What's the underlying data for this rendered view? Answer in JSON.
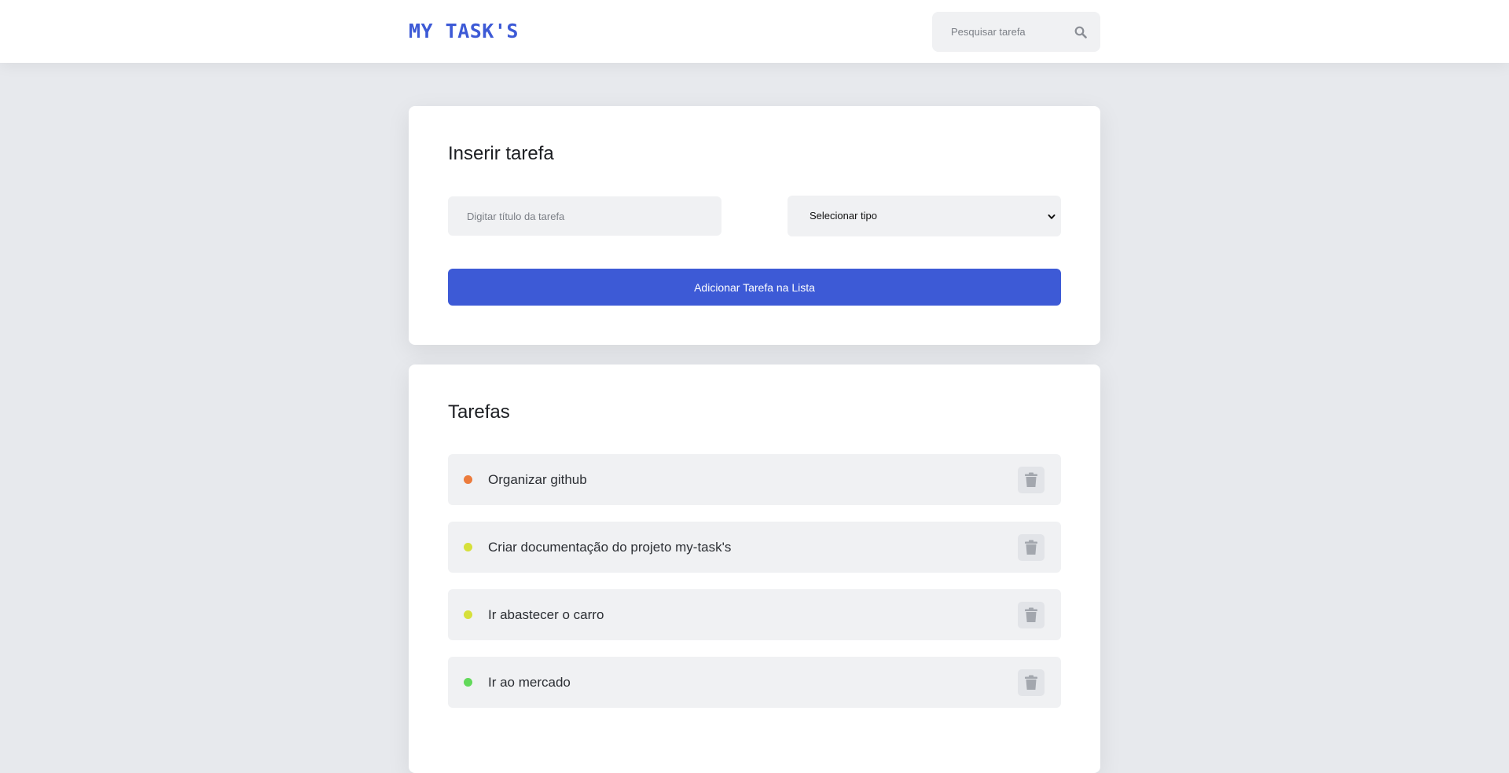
{
  "app": {
    "logo": "MY TASK'S"
  },
  "search": {
    "placeholder": "Pesquisar tarefa",
    "icon": "search-icon"
  },
  "insert": {
    "title": "Inserir tarefa",
    "title_placeholder": "Digitar título da tarefa",
    "type_select": {
      "selected": "Selecionar tipo",
      "icon": "chevron-down-icon"
    },
    "add_button": "Adicionar Tarefa na Lista"
  },
  "list": {
    "title": "Tarefas",
    "tasks": [
      {
        "label": "Organizar github",
        "dot_color": "#ec7b3c",
        "icon": "trash-icon"
      },
      {
        "label": "Criar documentação do projeto my-task's",
        "dot_color": "#d6e03a",
        "icon": "trash-icon"
      },
      {
        "label": "Ir abastecer o carro",
        "dot_color": "#d6e03a",
        "icon": "trash-icon"
      },
      {
        "label": "Ir ao mercado",
        "dot_color": "#62d95a",
        "icon": "trash-icon"
      }
    ]
  },
  "colors": {
    "accent": "#3d5ad6",
    "background": "#e7e9ed",
    "surface": "#ffffff",
    "field": "#f0f1f3"
  }
}
